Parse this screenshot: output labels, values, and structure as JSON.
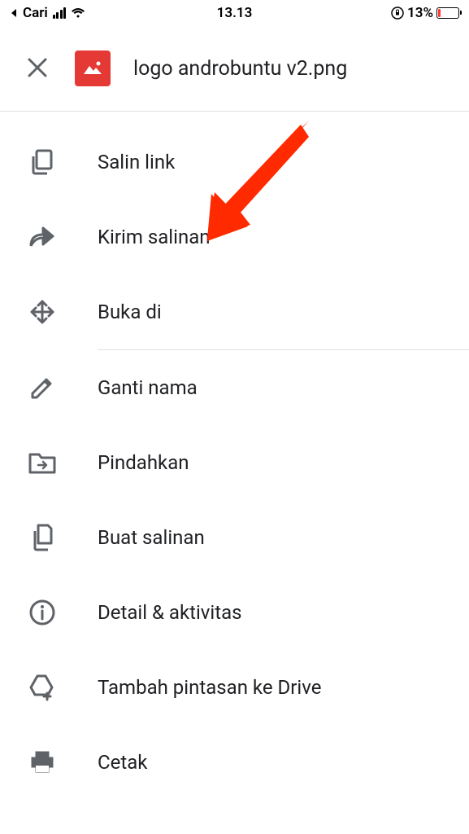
{
  "statusBar": {
    "carrier": "Cari",
    "time": "13.13",
    "batteryPercent": "13%"
  },
  "header": {
    "fileName": "logo androbuntu v2.png"
  },
  "menu": {
    "copyLink": "Salin link",
    "sendCopy": "Kirim salinan",
    "openIn": "Buka di",
    "rename": "Ganti nama",
    "move": "Pindahkan",
    "makeCopy": "Buat salinan",
    "details": "Detail & aktivitas",
    "addShortcut": "Tambah pintasan ke Drive",
    "print": "Cetak"
  }
}
